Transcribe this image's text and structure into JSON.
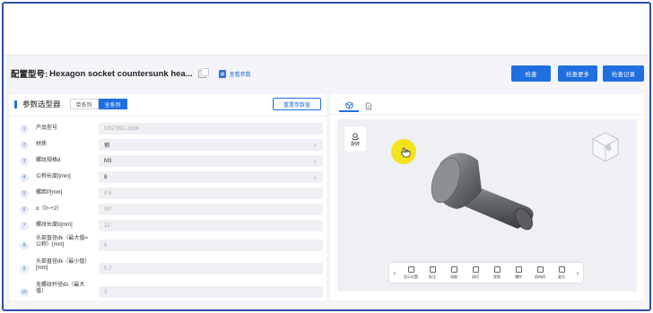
{
  "header": {
    "config_label": "配置型号:",
    "config_value": "Hexagon socket countersunk hea...",
    "view_params": "查看参数",
    "buttons": [
      "检查",
      "检查更多",
      "检查记录"
    ]
  },
  "left_panel": {
    "title": "参数选型器",
    "segments": [
      {
        "label": "单系列",
        "active": false
      },
      {
        "label": "全系列",
        "active": true
      }
    ],
    "reset_label": "重置参数值",
    "params": [
      {
        "num": "1",
        "label": "产品型号",
        "value": "DIN7991-1986",
        "editable": false,
        "dropdown": false
      },
      {
        "num": "2",
        "label": "材质",
        "value": "钢",
        "editable": true,
        "dropdown": true
      },
      {
        "num": "3",
        "label": "螺纹规格d",
        "value": "M3",
        "editable": true,
        "dropdown": true
      },
      {
        "num": "4",
        "label": "公称长度l[mm]",
        "value": "8",
        "editable": true,
        "dropdown": true
      },
      {
        "num": "5",
        "label": "螺距P[mm]",
        "value": "0.5",
        "editable": false,
        "dropdown": false
      },
      {
        "num": "6",
        "label": "α（0~+2）",
        "value": "90°",
        "editable": false,
        "dropdown": false
      },
      {
        "num": "7",
        "label": "螺纹长度b[mm]",
        "value": "12",
        "editable": false,
        "dropdown": false
      },
      {
        "num": "8",
        "label": "头部直径dk（最大值=公称）[mm]",
        "value": "6",
        "editable": false,
        "dropdown": false
      },
      {
        "num": "9",
        "label": "头部直径dk（最小值）[mm]",
        "value": "5.7",
        "editable": false,
        "dropdown": false
      },
      {
        "num": "10",
        "label": "无螺纹杆径ds（最大值）",
        "value": "3",
        "editable": false,
        "dropdown": false
      }
    ]
  },
  "right_panel": {
    "tabs": [
      {
        "icon": "cube-icon",
        "active": true
      },
      {
        "icon": "document-icon",
        "active": false
      }
    ],
    "rotate_label": "旋转",
    "toolbar": [
      {
        "icon": "display-settings-icon",
        "label": "显示设置"
      },
      {
        "icon": "annotate-icon",
        "label": "标注"
      },
      {
        "icon": "measure-icon",
        "label": "测量"
      },
      {
        "icon": "section-icon",
        "label": "剖切"
      },
      {
        "icon": "view-icon",
        "label": "视图"
      },
      {
        "icon": "explode-icon",
        "label": "爆炸"
      },
      {
        "icon": "structure-tree-icon",
        "label": "结构树"
      },
      {
        "icon": "reset-icon",
        "label": "复位"
      }
    ]
  },
  "colors": {
    "accent": "#1e6fe0",
    "frame_border": "#2f4fa8",
    "cursor_highlight": "#f3e21c"
  }
}
